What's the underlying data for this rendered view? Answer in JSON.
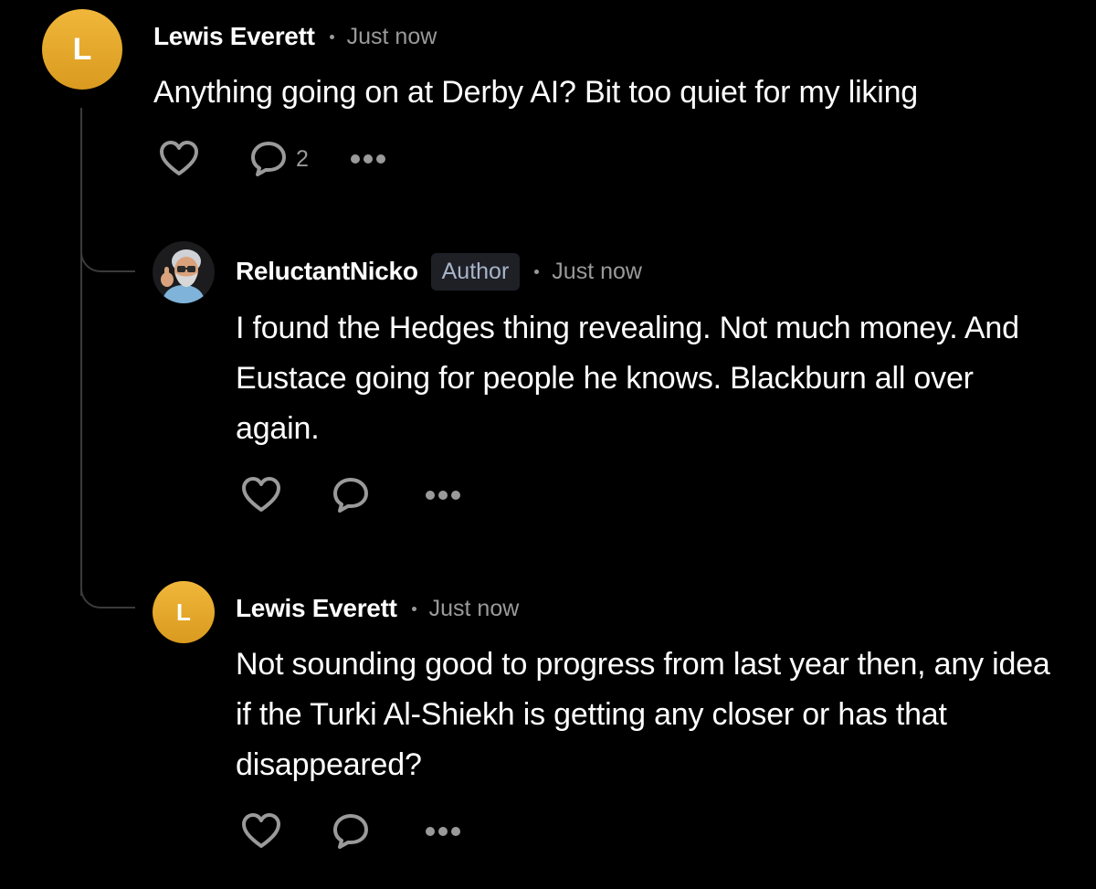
{
  "comments": [
    {
      "avatar_letter": "L",
      "author": "Lewis Everett",
      "time": "Just now",
      "text": "Anything going on at Derby AI? Bit too quiet for my liking",
      "reply_count": "2"
    },
    {
      "author": "ReluctantNicko",
      "badge": "Author",
      "time": "Just now",
      "text": "I found the Hedges thing revealing. Not much money. And Eustace going for people he knows. Blackburn all over again."
    },
    {
      "avatar_letter": "L",
      "author": "Lewis Everett",
      "time": "Just now",
      "text": "Not sounding good to progress from last year then, any idea if the Turki Al-Shiekh is getting any closer or has that disappeared?"
    }
  ],
  "colors": {
    "background": "#000000",
    "avatar_gold": "#e6a92a",
    "muted": "#9a9a9a",
    "thread_line": "#3a3a3a"
  },
  "icons": [
    "heart-icon",
    "comment-icon",
    "more-icon"
  ]
}
